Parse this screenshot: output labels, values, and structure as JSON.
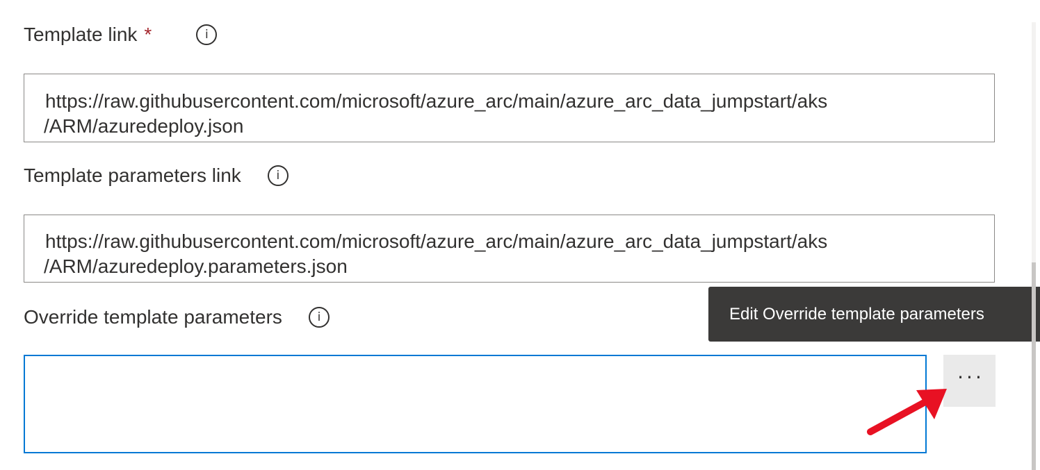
{
  "template_link": {
    "label": "Template link",
    "required_mark": "*",
    "value_line1": "https://raw.githubusercontent.com/microsoft/azure_arc/main/azure_arc_data_jumpstart/aks",
    "value_line2": "/ARM/azuredeploy.json"
  },
  "template_parameters_link": {
    "label": "Template parameters link",
    "value_line1": "https://raw.githubusercontent.com/microsoft/azure_arc/main/azure_arc_data_jumpstart/aks",
    "value_line2": "/ARM/azuredeploy.parameters.json"
  },
  "override_template_parameters": {
    "label": "Override template parameters",
    "value": "",
    "more_button_label": "···",
    "tooltip": "Edit Override template parameters"
  },
  "icons": {
    "info": "info-icon",
    "info_glyph": "i",
    "more": "more-horizontal-icon",
    "annotation": "red-arrow-annotation"
  },
  "colors": {
    "required": "#a4262c",
    "focus_border": "#0078d4",
    "tooltip_bg": "#3b3a39",
    "annotation_arrow": "#e81123"
  }
}
